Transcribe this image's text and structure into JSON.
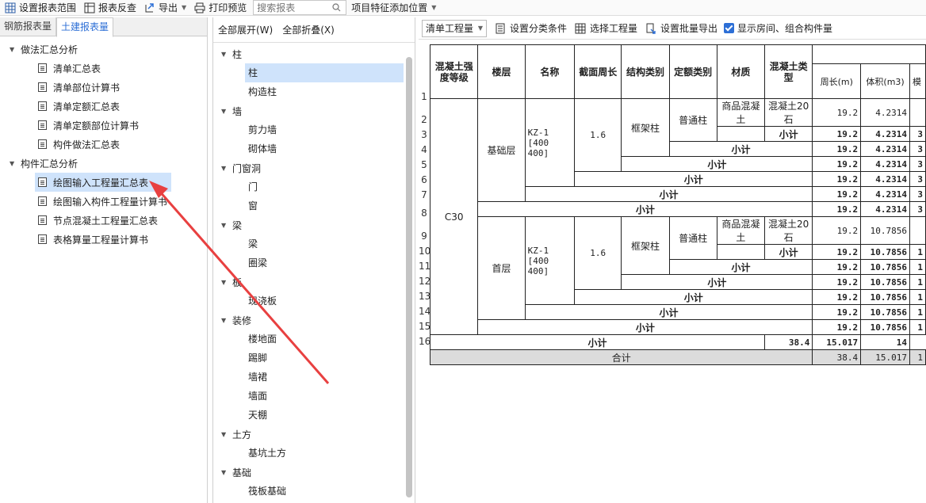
{
  "toolbar": {
    "set_range": "设置报表范围",
    "reverse_check": "报表反查",
    "export": "导出",
    "print_preview": "打印预览",
    "search_placeholder": "搜索报表",
    "add_position": "项目特征添加位置"
  },
  "left": {
    "tabs": [
      "钢筋报表量",
      "土建报表量"
    ],
    "groups": [
      {
        "label": "做法汇总分析",
        "items": [
          "清单汇总表",
          "清单部位计算书",
          "清单定额汇总表",
          "清单定额部位计算书",
          "构件做法汇总表"
        ]
      },
      {
        "label": "构件汇总分析",
        "items": [
          "绘图输入工程量汇总表",
          "绘图输入构件工程量计算书",
          "节点混凝土工程量汇总表",
          "表格算量工程量计算书"
        ]
      }
    ]
  },
  "mid": {
    "expand_all": "全部展开(W)",
    "collapse_all": "全部折叠(X)",
    "categories": [
      {
        "label": "柱",
        "items": [
          "柱",
          "构造柱"
        ]
      },
      {
        "label": "墙",
        "items": [
          "剪力墙",
          "砌体墙"
        ]
      },
      {
        "label": "门窗洞",
        "items": [
          "门",
          "窗"
        ]
      },
      {
        "label": "梁",
        "items": [
          "梁",
          "圈梁"
        ]
      },
      {
        "label": "板",
        "items": [
          "现浇板"
        ]
      },
      {
        "label": "装修",
        "items": [
          "楼地面",
          "踢脚",
          "墙裙",
          "墙面",
          "天棚"
        ]
      },
      {
        "label": "土方",
        "items": [
          "基坑土方"
        ]
      },
      {
        "label": "基础",
        "items": [
          "筏板基础"
        ]
      }
    ]
  },
  "right": {
    "combo": "清单工程量",
    "set_condition": "设置分类条件",
    "select_qty": "选择工程量",
    "batch_export": "设置批量导出",
    "show_room": "显示房间、组合构件量",
    "headers": {
      "grade": "混凝土强度等级",
      "floor": "楼层",
      "name": "名称",
      "perimeter": "截面周长",
      "struct": "结构类别",
      "quota": "定额类别",
      "material": "材质",
      "concrete": "混凝土类型",
      "len": "周长(m)",
      "vol": "体积(m3)",
      "more": "模"
    },
    "grade": "C30",
    "floors": [
      {
        "floor": "基础层",
        "name": "KZ-1 [400 400]",
        "perimeter": "1.6",
        "struct": "框架柱",
        "quota": "普通柱",
        "material": "商品混凝土",
        "concrete": "混凝土20石",
        "row1": {
          "len": "19.2",
          "vol": "4.2314",
          "more": ""
        },
        "subtotals": [
          {
            "label": "小计",
            "len": "19.2",
            "vol": "4.2314",
            "more": "3"
          },
          {
            "label": "小计",
            "len": "19.2",
            "vol": "4.2314",
            "more": "3"
          },
          {
            "label": "小计",
            "len": "19.2",
            "vol": "4.2314",
            "more": "3"
          },
          {
            "label": "小计",
            "len": "19.2",
            "vol": "4.2314",
            "more": "3"
          },
          {
            "label": "小计",
            "len": "19.2",
            "vol": "4.2314",
            "more": "3"
          },
          {
            "label": "小计",
            "len": "19.2",
            "vol": "4.2314",
            "more": "3"
          }
        ]
      },
      {
        "floor": "首层",
        "name": "KZ-1 [400 400]",
        "perimeter": "1.6",
        "struct": "框架柱",
        "quota": "普通柱",
        "material": "商品混凝土",
        "concrete": "混凝土20石",
        "row1": {
          "len": "19.2",
          "vol": "10.7856",
          "more": ""
        },
        "subtotals": [
          {
            "label": "小计",
            "len": "19.2",
            "vol": "10.7856",
            "more": "1"
          },
          {
            "label": "小计",
            "len": "19.2",
            "vol": "10.7856",
            "more": "1"
          },
          {
            "label": "小计",
            "len": "19.2",
            "vol": "10.7856",
            "more": "1"
          },
          {
            "label": "小计",
            "len": "19.2",
            "vol": "10.7856",
            "more": "1"
          },
          {
            "label": "小计",
            "len": "19.2",
            "vol": "10.7856",
            "more": "1"
          },
          {
            "label": "小计",
            "len": "19.2",
            "vol": "10.7856",
            "more": "1"
          }
        ]
      }
    ],
    "grade_subtotal": {
      "label": "小计",
      "len": "38.4",
      "vol": "15.017",
      "more": "14"
    },
    "total": {
      "label": "合计",
      "len": "38.4",
      "vol": "15.017",
      "more": "1"
    },
    "row_numbers": [
      "1",
      "2",
      "3",
      "4",
      "5",
      "6",
      "7",
      "8",
      "9",
      "10",
      "11",
      "12",
      "13",
      "14",
      "15",
      "16"
    ]
  }
}
